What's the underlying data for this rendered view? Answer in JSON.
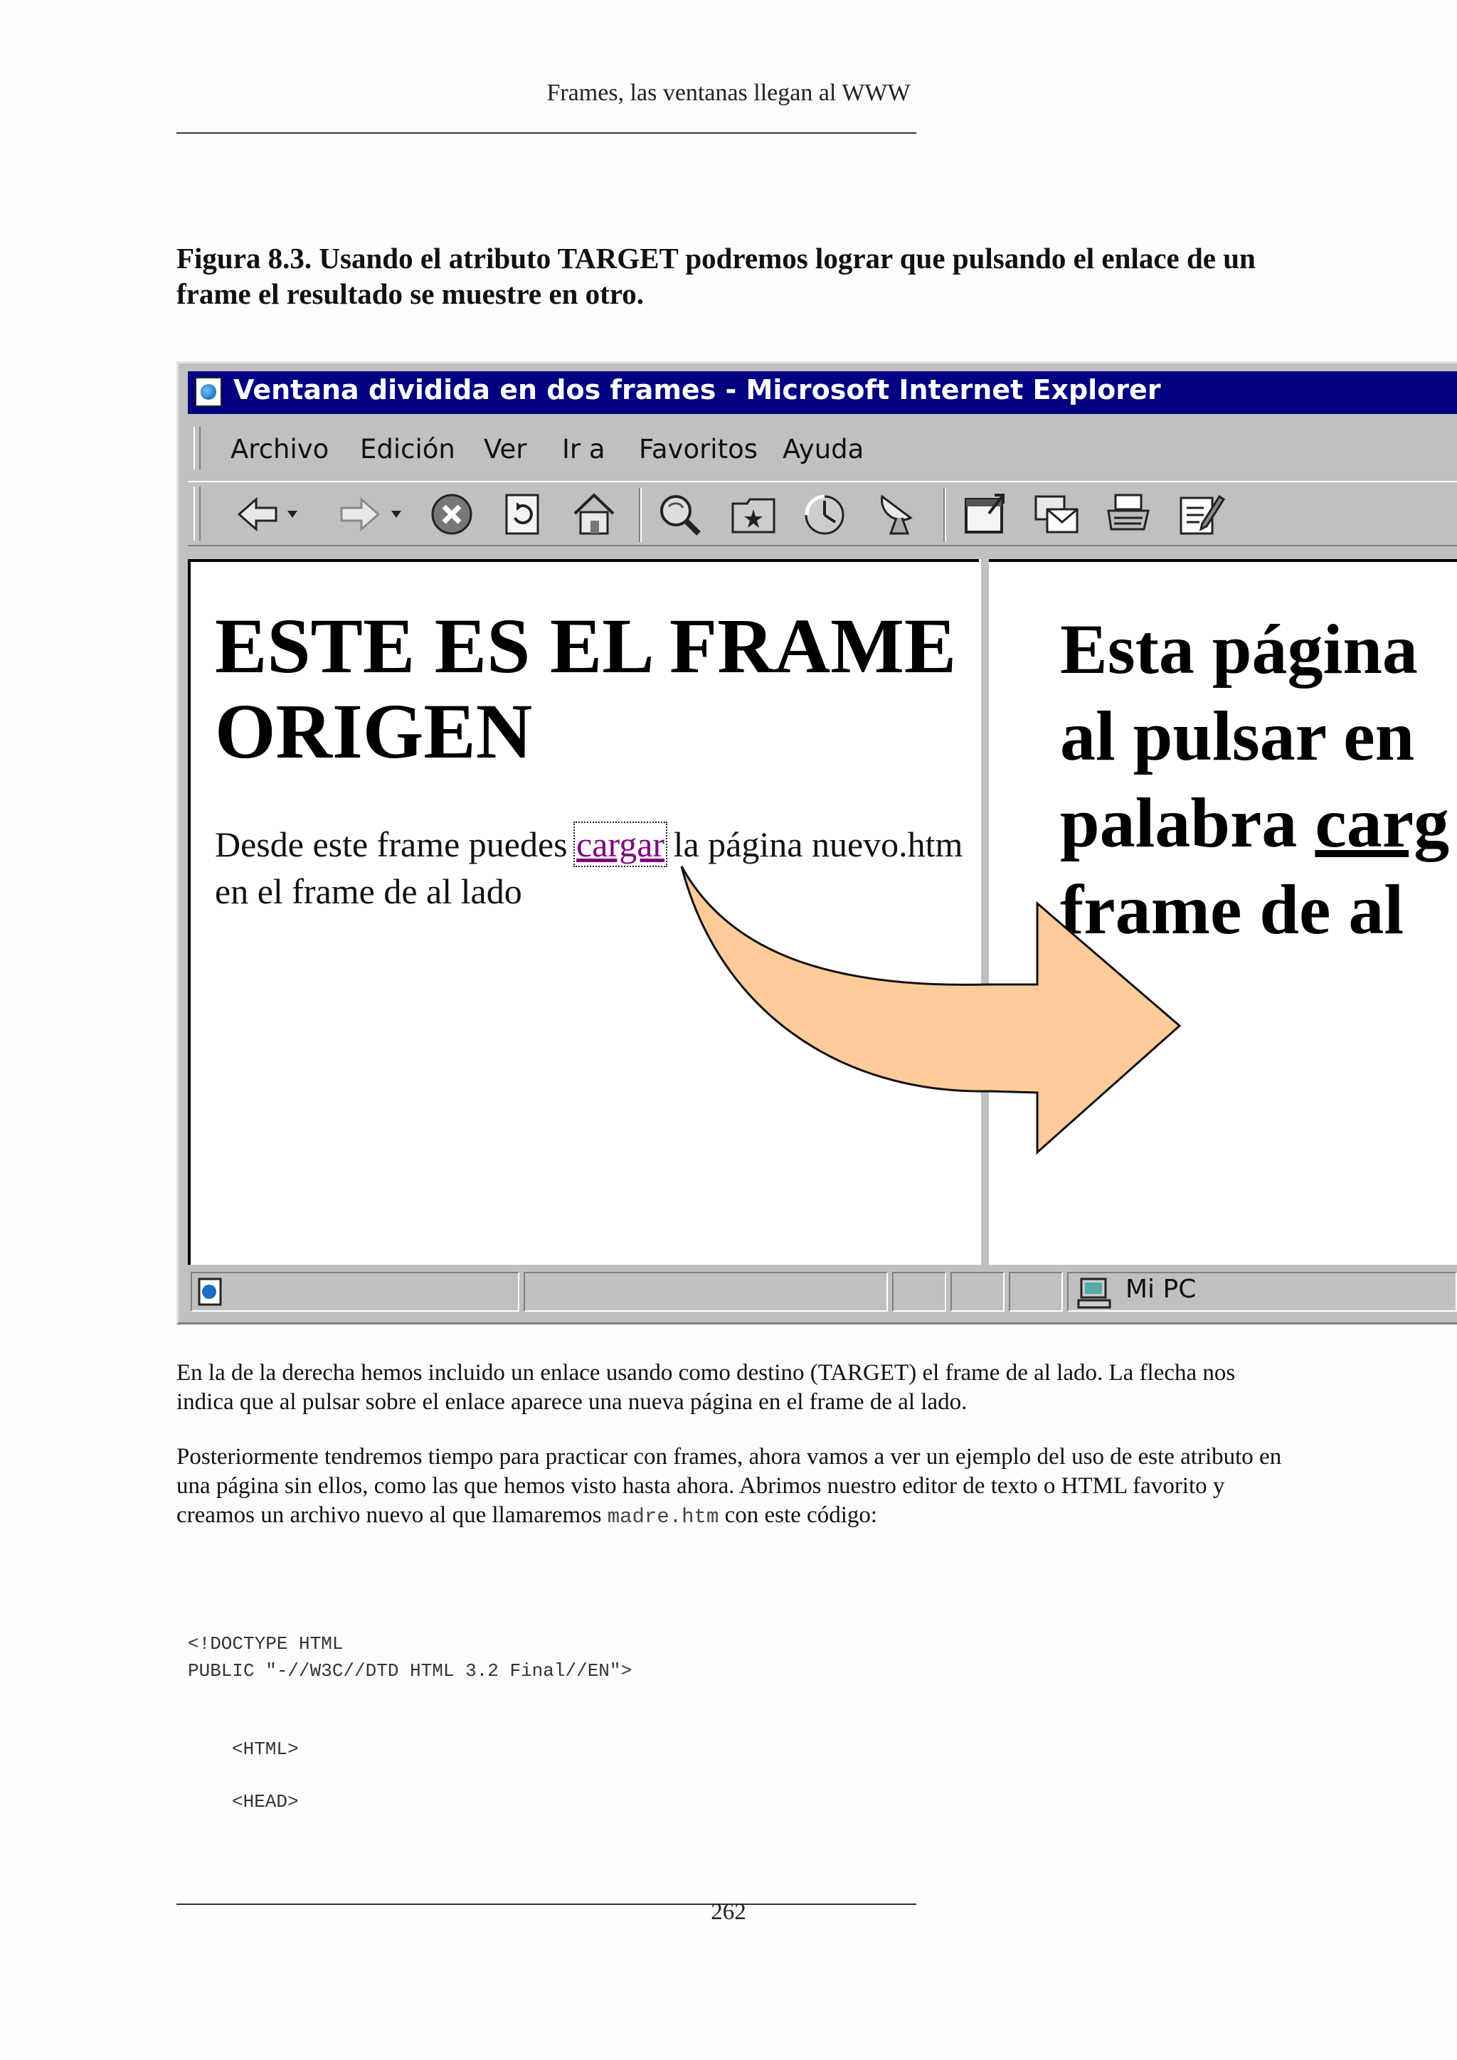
{
  "running_header": "Frames, las ventanas llegan al WWW",
  "figure_caption": "Figura 8.3.  Usando el atributo TARGET podremos lograr que pulsando el enlace de un frame el resultado se muestre en otro.",
  "browser": {
    "title": "Ventana dividida en dos frames - Microsoft Internet Explorer",
    "menu": [
      "Archivo",
      "Edición",
      "Ver",
      "Ir a",
      "Favoritos",
      "Ayuda"
    ],
    "toolbar_icons": [
      "back-icon",
      "forward-icon",
      "stop-icon",
      "refresh-icon",
      "home-icon",
      "search-icon",
      "favorites-icon",
      "history-icon",
      "channels-icon",
      "fullscreen-icon",
      "mail-icon",
      "print-icon",
      "edit-icon"
    ],
    "left_frame": {
      "heading": "ESTE ES EL FRAME ORIGEN",
      "text_before": "Desde este frame puedes ",
      "link": "cargar",
      "text_after": " la página nuevo.htm en el frame de al lado"
    },
    "right_frame": {
      "line1": "Esta página",
      "line2": "al pulsar en",
      "line3_before": "palabra ",
      "line3_link": "carg",
      "line4": "frame de al"
    },
    "status_zone": "Mi PC",
    "arrow_color": "#ffcc99"
  },
  "paragraph1": "En la de la derecha hemos incluido un enlace usando como destino (TARGET) el frame de al lado. La flecha nos indica que al pulsar sobre el enlace aparece una nueva página en el frame de al lado.",
  "paragraph2_before": "Posteriormente tendremos tiempo para practicar con frames, ahora vamos a ver un ejemplo del uso de este atributo en una página sin ellos, como las que hemos visto hasta ahora. Abrimos nuestro editor de texto o HTML favorito y creamos un archivo nuevo al que llamaremos ",
  "paragraph2_code": "madre.htm",
  "paragraph2_after": " con este código:",
  "code_lines": [
    "<!DOCTYPE HTML",
    "PUBLIC \"-//W3C//DTD HTML 3.2 Final//EN\">",
    "<HTML>",
    "<HEAD>"
  ],
  "page_number": "262"
}
